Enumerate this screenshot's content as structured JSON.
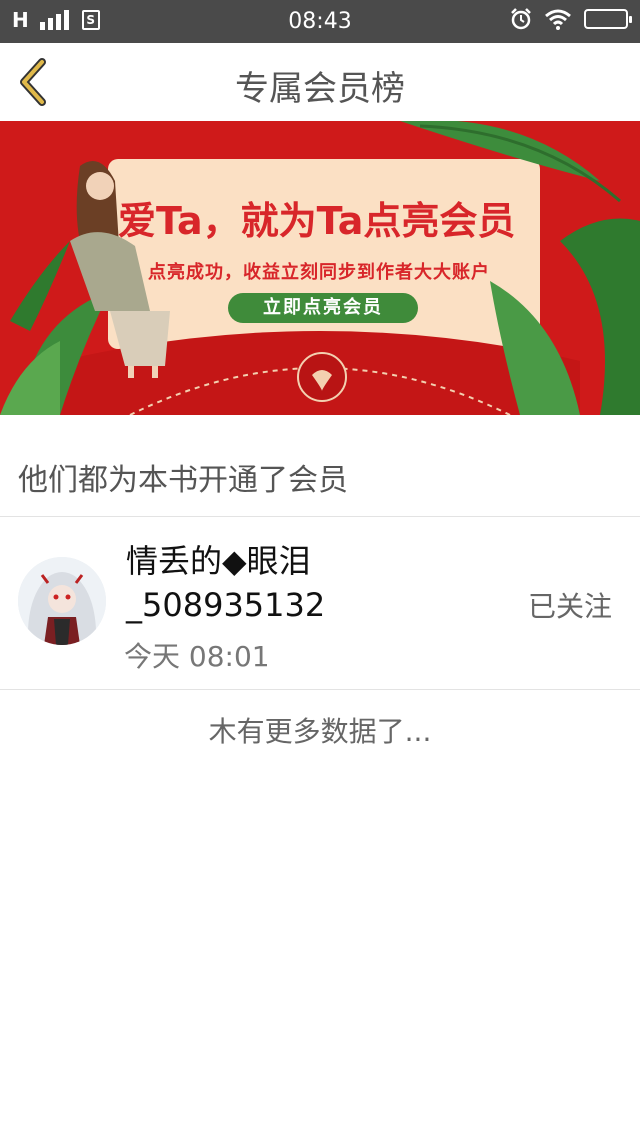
{
  "status_bar": {
    "signal": "H",
    "sim": "S",
    "time": "08:43"
  },
  "nav": {
    "title": "专属会员榜"
  },
  "banner": {
    "headline": "爱Ta，就为Ta点亮会员",
    "subtitle": "点亮成功，收益立刻同步到作者大大账户",
    "cta": "立即点亮会员"
  },
  "section": {
    "title": "他们都为本书开通了会员"
  },
  "members": [
    {
      "name": "情丢的◆眼泪_508935132",
      "time": "今天 08:01",
      "follow_status": "已关注"
    }
  ],
  "footer": {
    "no_more": "木有更多数据了..."
  },
  "colors": {
    "status_bar": "#4a4a4a",
    "banner_red": "#cf1a1a",
    "back_icon": "#d4a017",
    "cta_green": "#3f8b3a"
  }
}
